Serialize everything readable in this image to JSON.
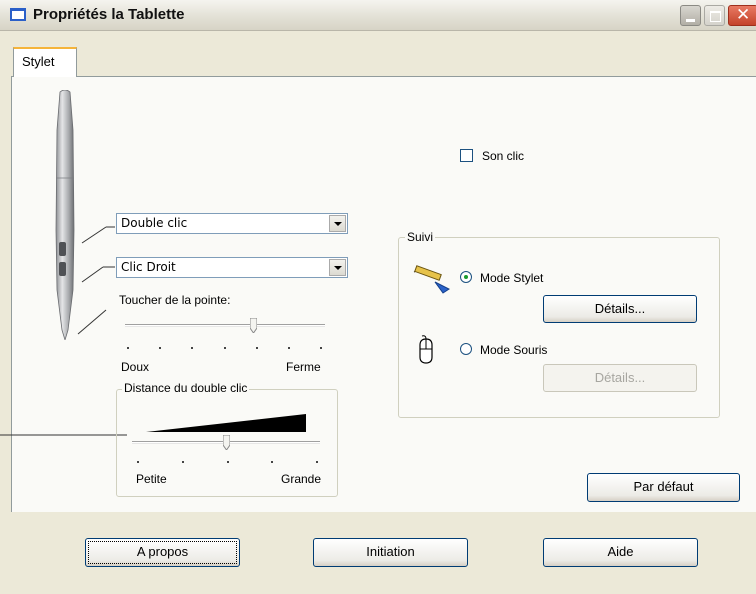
{
  "window": {
    "title": "Propriétés la Tablette"
  },
  "tabs": [
    {
      "label": "Stylet"
    }
  ],
  "pen_buttons": {
    "upper": {
      "value": "Double clic"
    },
    "lower": {
      "value": "Clic Droit"
    }
  },
  "tip_feel": {
    "label": "Toucher de la pointe:",
    "min_label": "Doux",
    "max_label": "Ferme",
    "level": 0.65
  },
  "double_click_distance": {
    "label": "Distance du double clic",
    "min_label": "Petite",
    "max_label": "Grande",
    "level": 0.5
  },
  "click_sound": {
    "label": "Son clic",
    "checked": false
  },
  "tracking": {
    "label": "Suivi",
    "pen_mode": {
      "label": "Mode Stylet",
      "selected": true,
      "details_label": "Détails..."
    },
    "mouse_mode": {
      "label": "Mode Souris",
      "selected": false,
      "details_label": "Détails..."
    }
  },
  "default_button": {
    "label": "Par défaut"
  },
  "footer": {
    "about_label": "A propos",
    "tutorial_label": "Initiation",
    "help_label": "Aide"
  },
  "colors": {
    "titlebar_close": "#c4432b",
    "radio_dot": "#1b9b2f",
    "focus_border": "#003c74"
  }
}
